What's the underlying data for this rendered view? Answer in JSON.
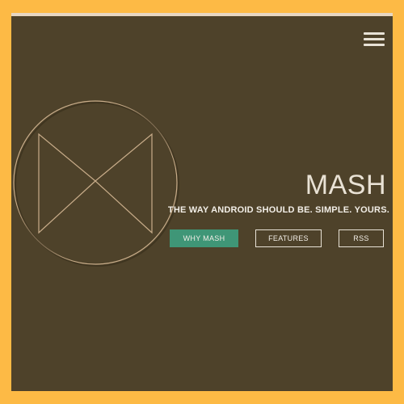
{
  "colors": {
    "page_background": "#FDBA45",
    "hero_background": "#4E422A",
    "accent": "#3F9677",
    "logo_stroke": "#C9AD8A",
    "text": "#E9E2D5"
  },
  "header": {
    "menu_icon": "hamburger-menu-icon"
  },
  "hero": {
    "title": "MASH",
    "tagline": "THE WAY ANDROID SHOULD BE. SIMPLE. YOURS.",
    "logo_icon": "bowtie-circle-logo"
  },
  "buttons": {
    "why": "WHY MASH",
    "features": "FEATURES",
    "rss": "RSS"
  }
}
